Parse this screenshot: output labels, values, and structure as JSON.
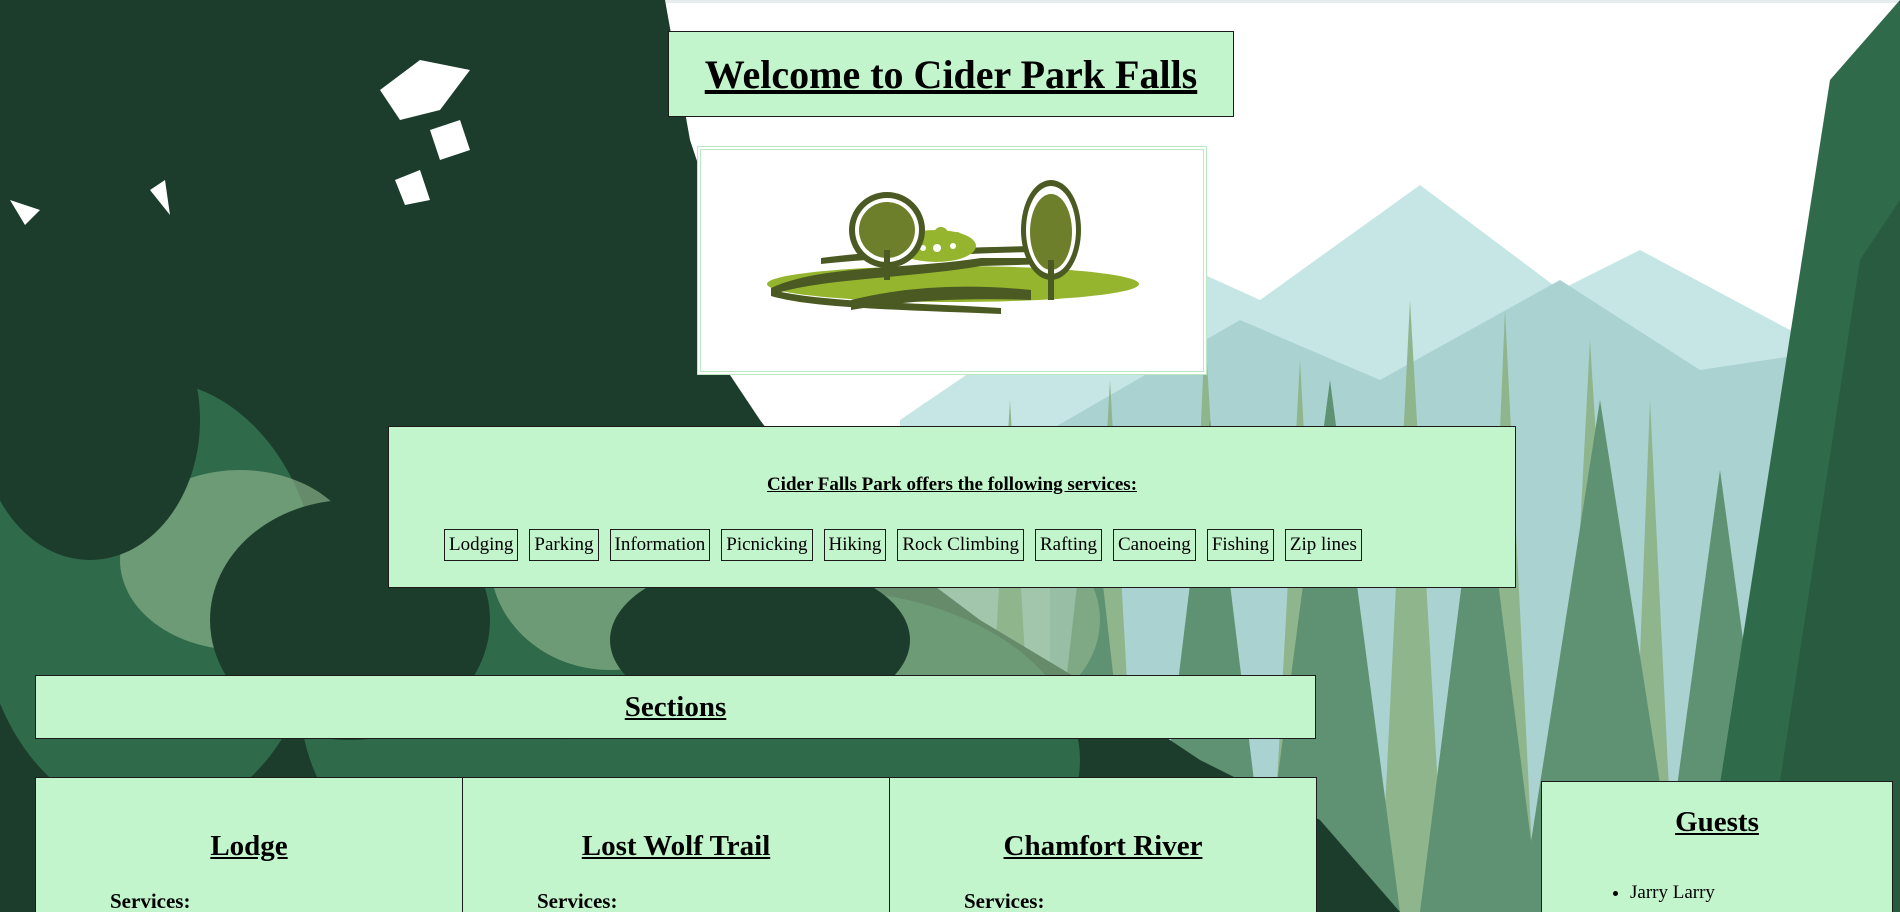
{
  "header": {
    "title": "Welcome to Cider Park Falls"
  },
  "logo": {
    "icon": "park-landscape-logo",
    "colors": {
      "dark_olive": "#4b5a22",
      "mid_olive": "#6d7f2a",
      "light_green": "#95b52f"
    }
  },
  "services": {
    "heading": "Cider Falls Park offers the following services:",
    "items": [
      "Lodging",
      "Parking",
      "Information",
      "Picnicking",
      "Hiking",
      "Rock Climbing",
      "Rafting",
      "Canoeing",
      "Fishing",
      "Zip lines"
    ]
  },
  "sections": {
    "heading": "Sections",
    "cards": [
      {
        "title": "Lodge",
        "services_label": "Services:"
      },
      {
        "title": "Lost Wolf Trail",
        "services_label": "Services:"
      },
      {
        "title": "Chamfort River",
        "services_label": "Services:"
      }
    ]
  },
  "guests": {
    "heading": "Guests",
    "items": [
      "Jarry Larry"
    ]
  },
  "theme": {
    "panel_color": "#c3f5cd",
    "forest_dark": "#1c3d2c",
    "forest_mid": "#2f6a4a",
    "forest_light": "#8fb58d",
    "mountain_color": "#c6e6e6"
  }
}
